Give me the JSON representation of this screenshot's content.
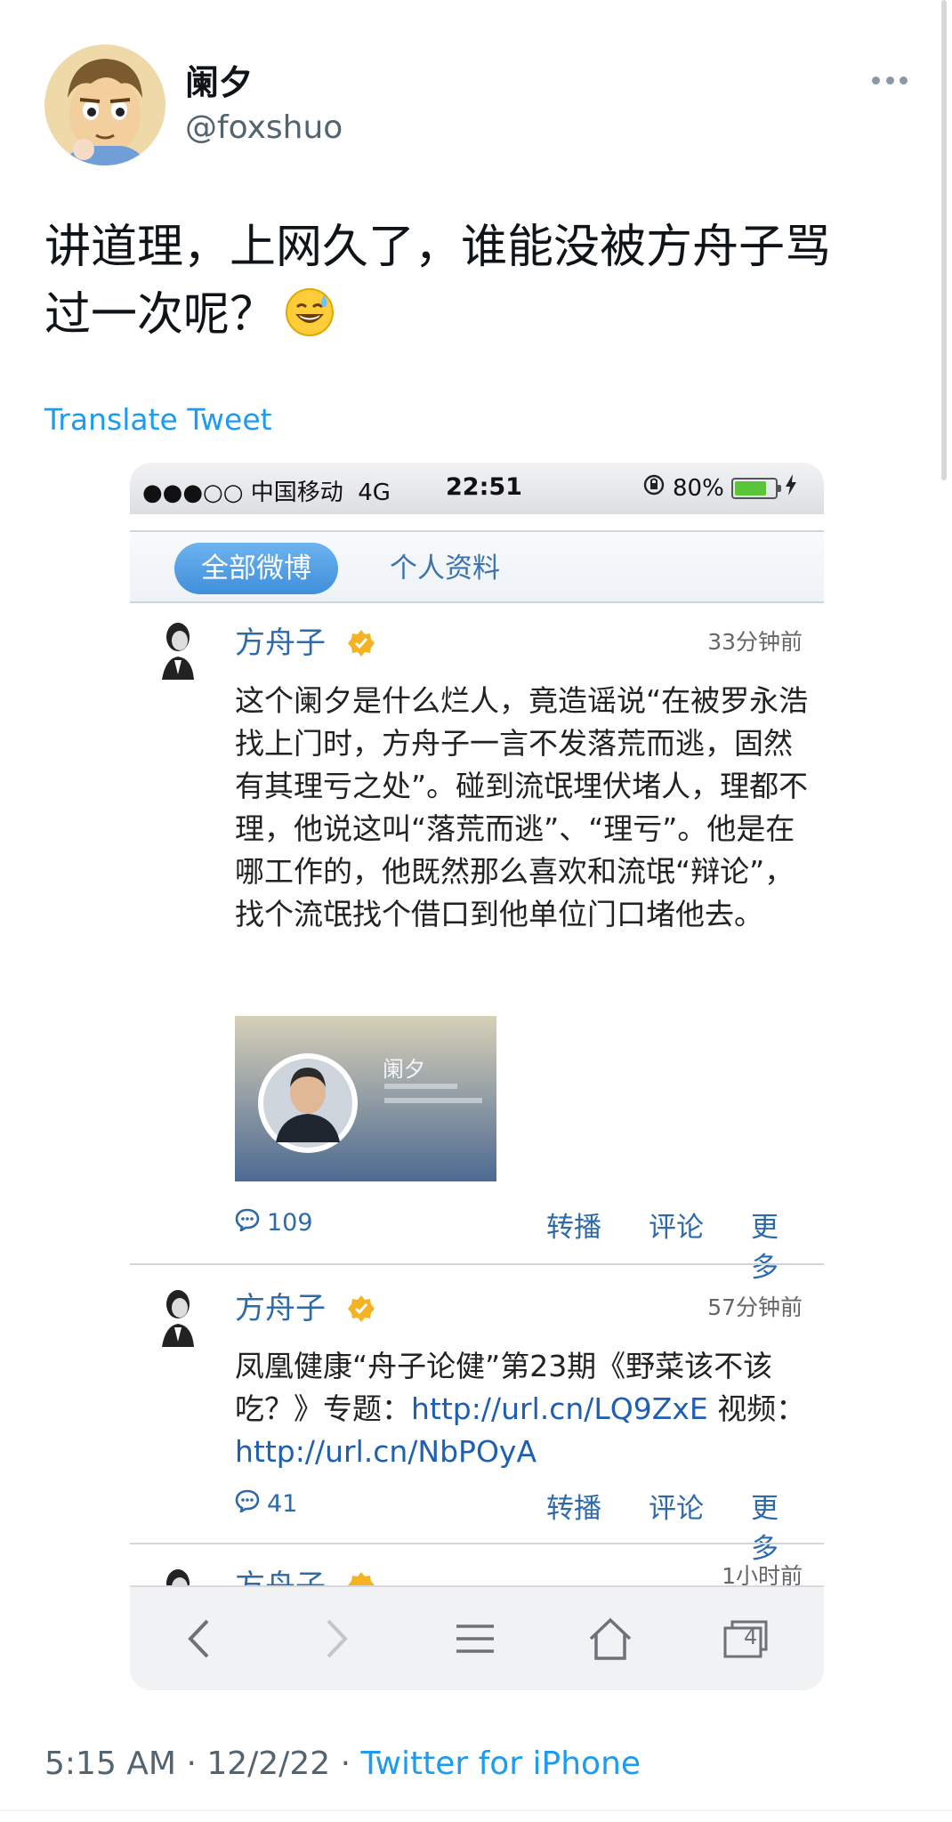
{
  "tweet": {
    "display_name": "阑夕",
    "handle": "@foxshuo",
    "text_line1": "讲道理，上网久了，谁能没被方舟子骂",
    "text_line2": "过一次呢？",
    "emoji": "😅",
    "translate_label": "Translate Tweet",
    "time": "5:15 AM",
    "date": "12/2/22",
    "separator": "·",
    "client": "Twitter for iPhone"
  },
  "embedded": {
    "status": {
      "carrier": "●●●○○ 中国移动",
      "network": "4G",
      "time": "22:51",
      "battery": "80%"
    },
    "tabs": {
      "active": "全部微博",
      "profile": "个人资料"
    },
    "posts": [
      {
        "author": "方舟子",
        "time": "33分钟前",
        "body": "这个阑夕是什么烂人，竟造谣说“在被罗永浩找上门时，方舟子一言不发落荒而逃，固然有其理亏之处”。碰到流氓埋伏堵人，理都不理，他说这叫“落荒而逃”、“理亏”。他是在哪工作的，他既然那么喜欢和流氓“辩论”，找个流氓找个借口到他单位门口堵他去。",
        "image_name": "阑夕",
        "comments": "109",
        "repost": "转播",
        "comment": "评论",
        "more": "更多"
      },
      {
        "author": "方舟子",
        "time": "57分钟前",
        "body_prefix": "凤凰健康“舟子论健”第23期《野菜该不该吃？》专题：",
        "link1": "http://url.cn/LQ9ZxE",
        "body_mid": " 视频：",
        "link2": "http://url.cn/NbPOyA",
        "comments": "41",
        "repost": "转播",
        "comment": "评论",
        "more": "更多"
      },
      {
        "author": "方舟子",
        "time": "1小时前"
      }
    ],
    "browser": {
      "tab_count": "4"
    }
  },
  "colors": {
    "accent": "#1d9bf0",
    "weibo_link": "#2f6aa8",
    "tab_active": "#4a98e2"
  }
}
